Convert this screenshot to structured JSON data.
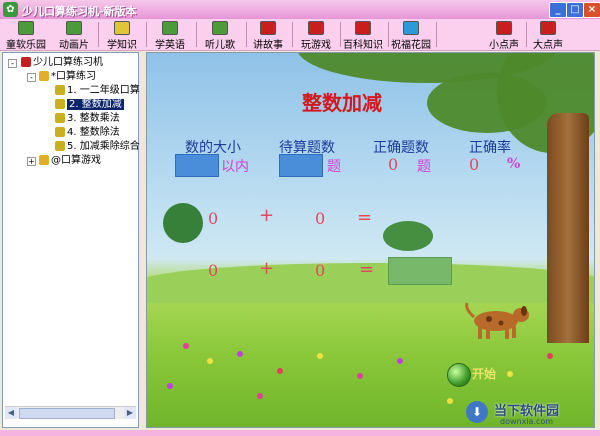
{
  "window": {
    "title": "少儿口算练习机-新版本"
  },
  "toolbar": {
    "buttons": [
      {
        "label": "童软乐园",
        "color": "#4b9b3a"
      },
      {
        "label": "动画片",
        "color": "#4b9b3a"
      },
      {
        "label": "学知识",
        "color": "#e0c43a"
      },
      {
        "label": "学英语",
        "color": "#4b9b3a"
      },
      {
        "label": "听儿歌",
        "color": "#4b9b3a"
      },
      {
        "label": "讲故事",
        "color": "#c81e1e"
      },
      {
        "label": "玩游戏",
        "color": "#c81e1e"
      },
      {
        "label": "百科知识",
        "color": "#c81e1e"
      },
      {
        "label": "祝福花园",
        "color": "#2d9ad8"
      },
      {
        "label": "小点声",
        "color": "#c81e1e"
      },
      {
        "label": "大点声",
        "color": "#c81e1e"
      }
    ]
  },
  "tree": {
    "root": "少儿口算练习机",
    "group1": "*口算练习",
    "items": [
      "1. 一二年级口算",
      "2. 整数加减",
      "3. 整数乘法",
      "4. 整数除法",
      "5. 加减乘除综合"
    ],
    "selected_index": 1,
    "group2": "@口算游戏"
  },
  "game": {
    "title": "整数加减",
    "labels": {
      "count": "数的大小",
      "pending": "待算题数",
      "correct": "正确题数",
      "rate": "正确率"
    },
    "count_unit": "以内",
    "pending_unit": "题",
    "correct_value": "0",
    "correct_unit": "题",
    "rate_value": "0",
    "rate_unit": "%",
    "row1": {
      "a": "0",
      "op": "+",
      "b": "0",
      "eq": "="
    },
    "row2": {
      "a": "0",
      "op": "+",
      "b": "0",
      "eq": "="
    },
    "start_label": "开始"
  },
  "watermark": {
    "main": "当下软件园",
    "sub": "downxia.com"
  },
  "colors": {
    "title_red": "#d4181e",
    "label_blue": "#1e3a9a",
    "unit_pink": "#d93fd0",
    "number_red": "#e04a5a"
  }
}
